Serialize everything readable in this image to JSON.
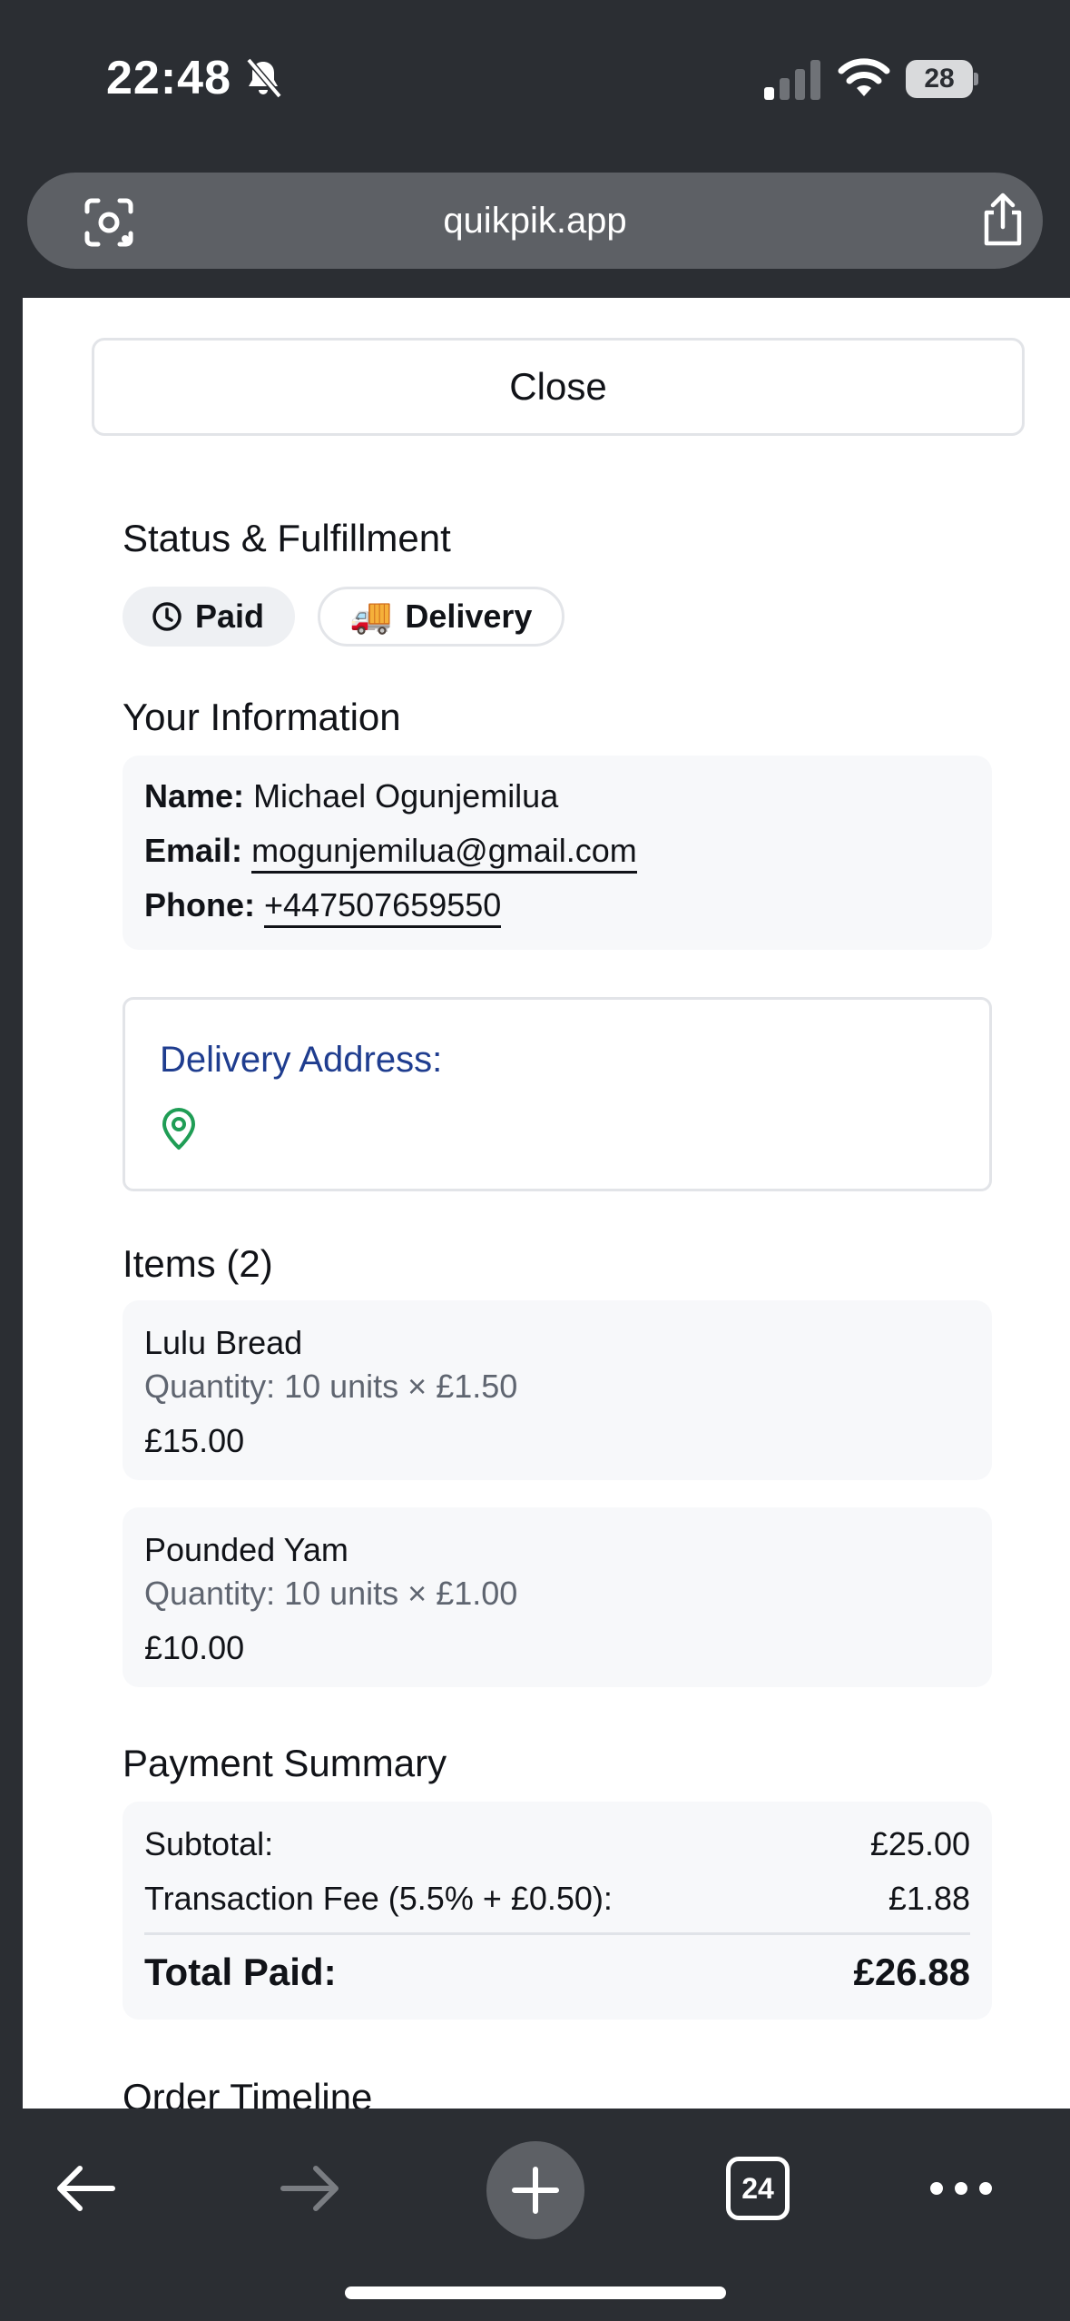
{
  "status_bar": {
    "time": "22:48",
    "battery": "28"
  },
  "browser": {
    "url": "quikpik.app",
    "tab_count": "24"
  },
  "close_label": "Close",
  "status": {
    "heading": "Status & Fulfillment",
    "payment_chip": "Paid",
    "fulfillment_chip": "Delivery",
    "fulfillment_emoji": "🚚"
  },
  "info": {
    "heading": "Your Information",
    "name_label": "Name:",
    "name": "Michael Ogunjemilua",
    "email_label": "Email:",
    "email": "mogunjemilua@gmail.com",
    "phone_label": "Phone:",
    "phone": "+447507659550"
  },
  "delivery": {
    "title": "Delivery Address:"
  },
  "items": {
    "heading": "Items (2)",
    "list": [
      {
        "name": "Lulu Bread",
        "quantity": "Quantity: 10 units × £1.50",
        "price": "£15.00"
      },
      {
        "name": "Pounded Yam",
        "quantity": "Quantity: 10 units × £1.00",
        "price": "£10.00"
      }
    ]
  },
  "payment": {
    "heading": "Payment Summary",
    "subtotal_label": "Subtotal:",
    "subtotal": "£25.00",
    "fee_label": "Transaction Fee (5.5% + £0.50):",
    "fee": "£1.88",
    "total_label": "Total Paid:",
    "total": "£26.88"
  },
  "timeline": {
    "heading": "Order Timeline"
  },
  "colors": {
    "chrome_bg": "#2b2e33",
    "url_pill": "#5d6065",
    "address_title": "#1f3d8f",
    "pin_green": "#1f9d55",
    "panel_bg": "#f7f8fa"
  }
}
